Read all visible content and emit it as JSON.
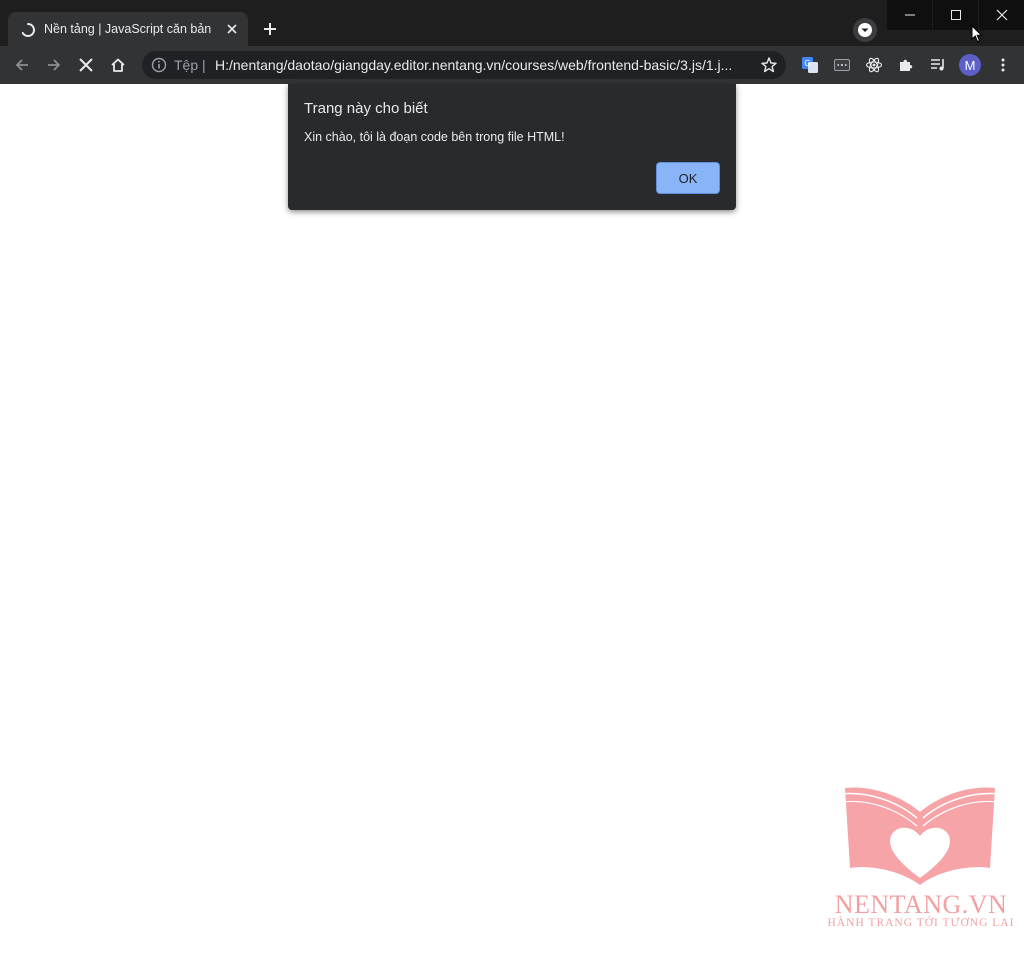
{
  "tab": {
    "title": "Nền tảng | JavaScript căn bản",
    "loading_icon": "spinner-icon",
    "close_icon": "close-icon"
  },
  "omnibox": {
    "security_label": "Tệp |",
    "url": "H:/nentang/daotao/giangday.editor.nentang.vn/courses/web/frontend-basic/3.js/1.j..."
  },
  "profile": {
    "initial": "M"
  },
  "dialog": {
    "title": "Trang này cho biết",
    "message": "Xin chào, tôi là đoạn code bên trong file HTML!",
    "ok_label": "OK"
  },
  "watermark": {
    "brand": "NENTANG.VN",
    "tagline": "HÀNH TRANG TỚI TƯƠNG LAI"
  },
  "colors": {
    "accent": "#8ab4f8",
    "watermark": "#f3a0a3",
    "avatar": "#5b5fc7"
  }
}
